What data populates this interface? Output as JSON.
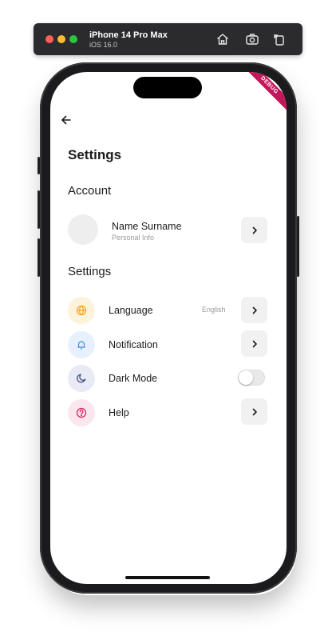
{
  "simulator": {
    "device_name": "iPhone 14 Pro Max",
    "os_version": "iOS 16.0",
    "buttons": [
      {
        "icon": "home-icon"
      },
      {
        "icon": "screenshot-icon"
      },
      {
        "icon": "rotate-icon"
      }
    ]
  },
  "debug_banner": "DEBUG",
  "header": {
    "back_icon": "arrow-left-icon",
    "title": "Settings"
  },
  "account": {
    "section_title": "Account",
    "name": "Name Surname",
    "subtitle": "Personal Info"
  },
  "settings": {
    "section_title": "Settings",
    "items": [
      {
        "label": "Language",
        "value": "English",
        "icon": "globe-icon",
        "icon_color": "#f2a516",
        "icon_bg": "#fdf3dc"
      },
      {
        "label": "Notification",
        "icon": "bell-icon",
        "icon_color": "#3d8ef0",
        "icon_bg": "#e7f1fd"
      },
      {
        "label": "Dark Mode",
        "icon": "moon-icon",
        "icon_color": "#2c3e70",
        "icon_bg": "#e8ebf5",
        "toggle_on": false
      },
      {
        "label": "Help",
        "icon": "question-circle-icon",
        "icon_color": "#d81b60",
        "icon_bg": "#fce6ee"
      }
    ]
  },
  "colors": {
    "button_bg": "#f1f1f2",
    "ribbon": "#c2185b"
  }
}
